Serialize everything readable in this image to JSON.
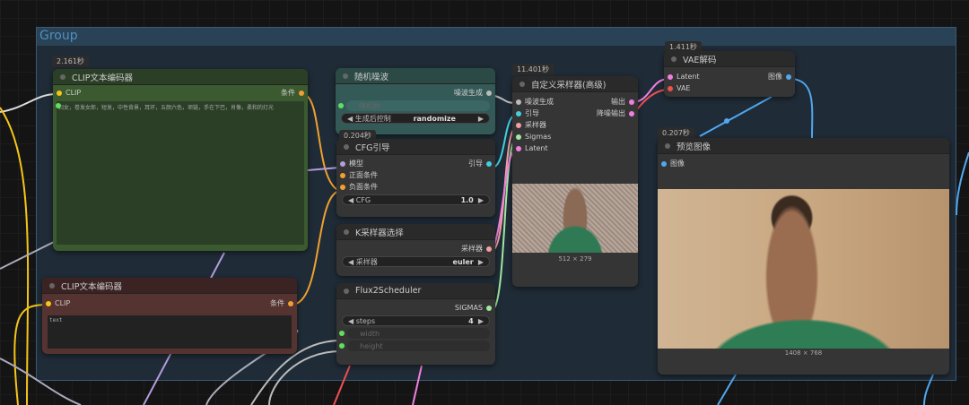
{
  "group": {
    "title": "Group"
  },
  "clip_pos": {
    "time": "2.161秒",
    "title": "CLIP文本编码器",
    "input": "CLIP",
    "output": "条件",
    "text": "妇女，卷发女郎，短发，中性背景，耳环，五颜六色，项链，手在下巴，肖像，柔和的灯光"
  },
  "clip_neg": {
    "title": "CLIP文本编码器",
    "input": "CLIP",
    "output": "条件",
    "text": "text"
  },
  "noise": {
    "title": "随机噪波",
    "output": "噪波生成",
    "seed_label": "随机种",
    "control_label": "生成后控制",
    "control_value": "randomize"
  },
  "cfg": {
    "time": "0.204秒",
    "title": "CFG引导",
    "inputs": [
      "模型",
      "正面条件",
      "负面条件"
    ],
    "output": "引导",
    "cfg_label": "CFG",
    "cfg_value": "1.0"
  },
  "ksel": {
    "title": "K采样器选择",
    "output": "采样器",
    "sampler_label": "采样器",
    "sampler_value": "euler"
  },
  "sched": {
    "title": "Flux2Scheduler",
    "output": "SIGMAS",
    "steps_label": "steps",
    "steps_value": "4",
    "width_label": "width",
    "height_label": "height"
  },
  "sampler": {
    "time": "11.401秒",
    "title": "自定义采样器(高级)",
    "inputs": [
      "噪波生成",
      "引导",
      "采样器",
      "Sigmas",
      "Latent"
    ],
    "outputs": [
      "输出",
      "降噪输出"
    ],
    "image_size": "512 × 279"
  },
  "vae": {
    "time": "1.411秒",
    "title": "VAE解码",
    "inputs": [
      "Latent",
      "VAE"
    ],
    "output": "图像"
  },
  "preview": {
    "time": "0.207秒",
    "title": "预览图像",
    "input": "图像",
    "image_size": "1408 × 768"
  },
  "colors": {
    "clip": "#f5c518",
    "cond": "#f0a030",
    "model": "#b39ddb",
    "guider": "#40d0e0",
    "sampler": "#f0a0a0",
    "sigmas": "#a0e8a0",
    "latent": "#f080e0",
    "vae": "#f05050",
    "image": "#50a8f0",
    "noise": "#bbbbbb",
    "int": "#60e060"
  }
}
